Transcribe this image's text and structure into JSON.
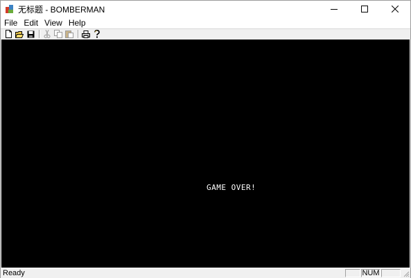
{
  "window": {
    "title": "无标题 - BOMBERMAN",
    "app_icon": "paint-app-icon",
    "controls": [
      "minimize-icon",
      "maximize-icon",
      "close-icon"
    ]
  },
  "menu": {
    "items": [
      "File",
      "Edit",
      "View",
      "Help"
    ]
  },
  "toolbar": {
    "buttons": [
      "new-file-icon",
      "open-folder-icon",
      "save-icon",
      "cut-icon",
      "copy-icon",
      "paste-icon",
      "print-icon",
      "help-icon"
    ]
  },
  "game": {
    "message": "GAME OVER!",
    "background": "#000000",
    "text_color": "#ffffff"
  },
  "statusbar": {
    "text": "Ready",
    "panes": [
      "",
      "NUM",
      ""
    ]
  }
}
